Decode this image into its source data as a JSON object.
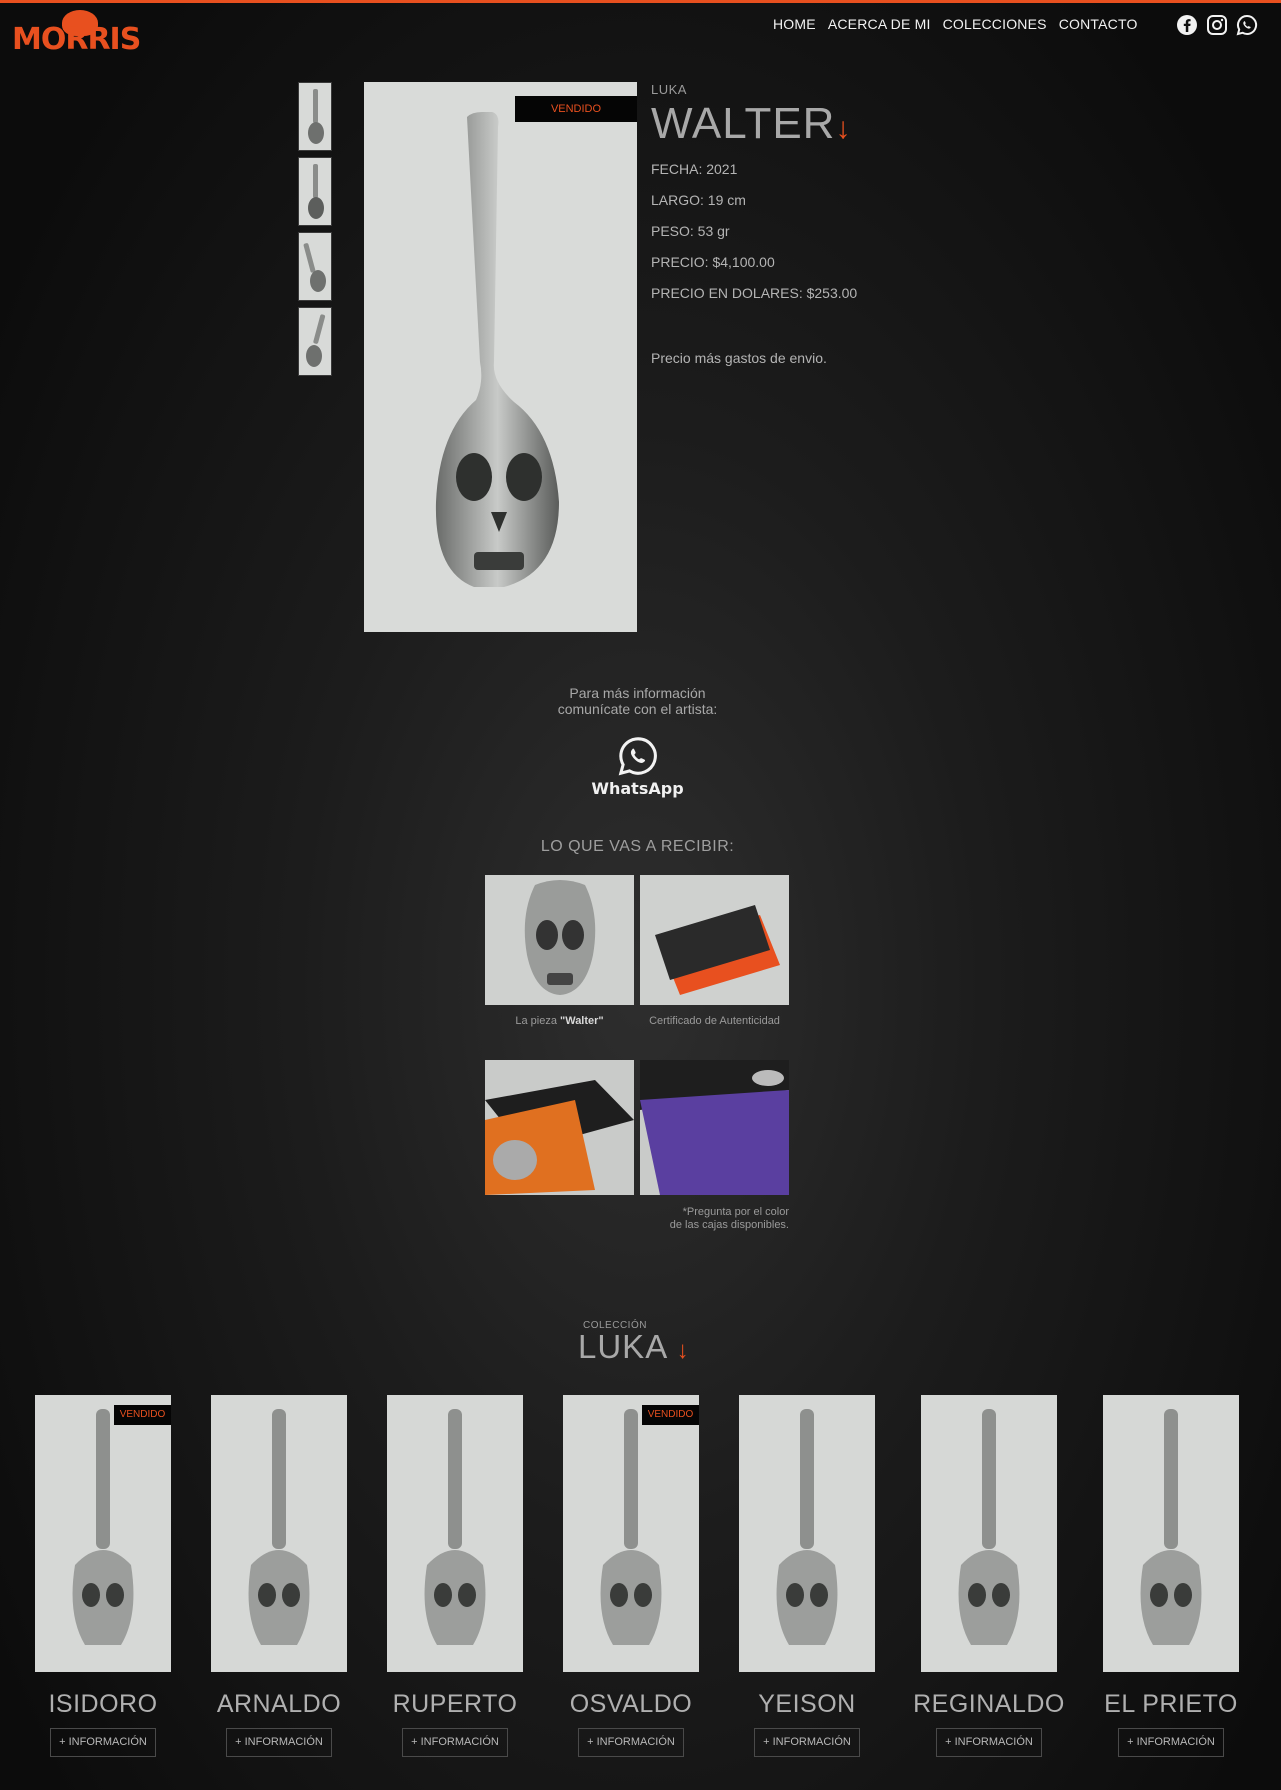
{
  "header": {
    "logo_text": "MORRIS",
    "nav": [
      "HOME",
      "ACERCA DE MI",
      "COLECCIONES",
      "CONTACTO"
    ],
    "social_icons": [
      "facebook-icon",
      "instagram-icon",
      "whatsapp-icon"
    ]
  },
  "product": {
    "collection": "LUKA",
    "name": "WALTER",
    "arrow": "↓",
    "badge": "VENDIDO",
    "specs": {
      "fecha": "FECHA: 2021",
      "largo": "LARGO: 19 cm",
      "peso": "PESO: 53 gr",
      "precio": "PRECIO: $4,100.00",
      "precio_usd": "PRECIO EN DOLARES: $253.00"
    },
    "shipping_note": "Precio más gastos de envio."
  },
  "contact": {
    "line1": "Para más información",
    "line2": "comunícate con el artista:",
    "whatsapp_label": "WhatsApp"
  },
  "receive": {
    "title": "LO QUE VAS A RECIBIR:",
    "caption_piece_prefix": "La pieza ",
    "caption_piece_name": "\"Walter\"",
    "caption_cert": "Certificado de Autenticidad",
    "note_line1": "*Pregunta por el color",
    "note_line2": "de las cajas disponibles."
  },
  "collection": {
    "label": "COLECCIÓN",
    "name": "LUKA",
    "arrow": "↓",
    "button_label": "+ INFORMACIÓN",
    "items": [
      {
        "name": "ISIDORO",
        "badge": "VENDIDO"
      },
      {
        "name": "ARNALDO",
        "badge": ""
      },
      {
        "name": "RUPERTO",
        "badge": ""
      },
      {
        "name": "OSVALDO",
        "badge": "VENDIDO"
      },
      {
        "name": "YEISON",
        "badge": ""
      },
      {
        "name": "REGINALDO",
        "badge": ""
      },
      {
        "name": "EL PRIETO",
        "badge": ""
      }
    ]
  },
  "colors": {
    "accent": "#e8501f",
    "background": "#1c1c1c",
    "text": "#bdbdbd"
  }
}
